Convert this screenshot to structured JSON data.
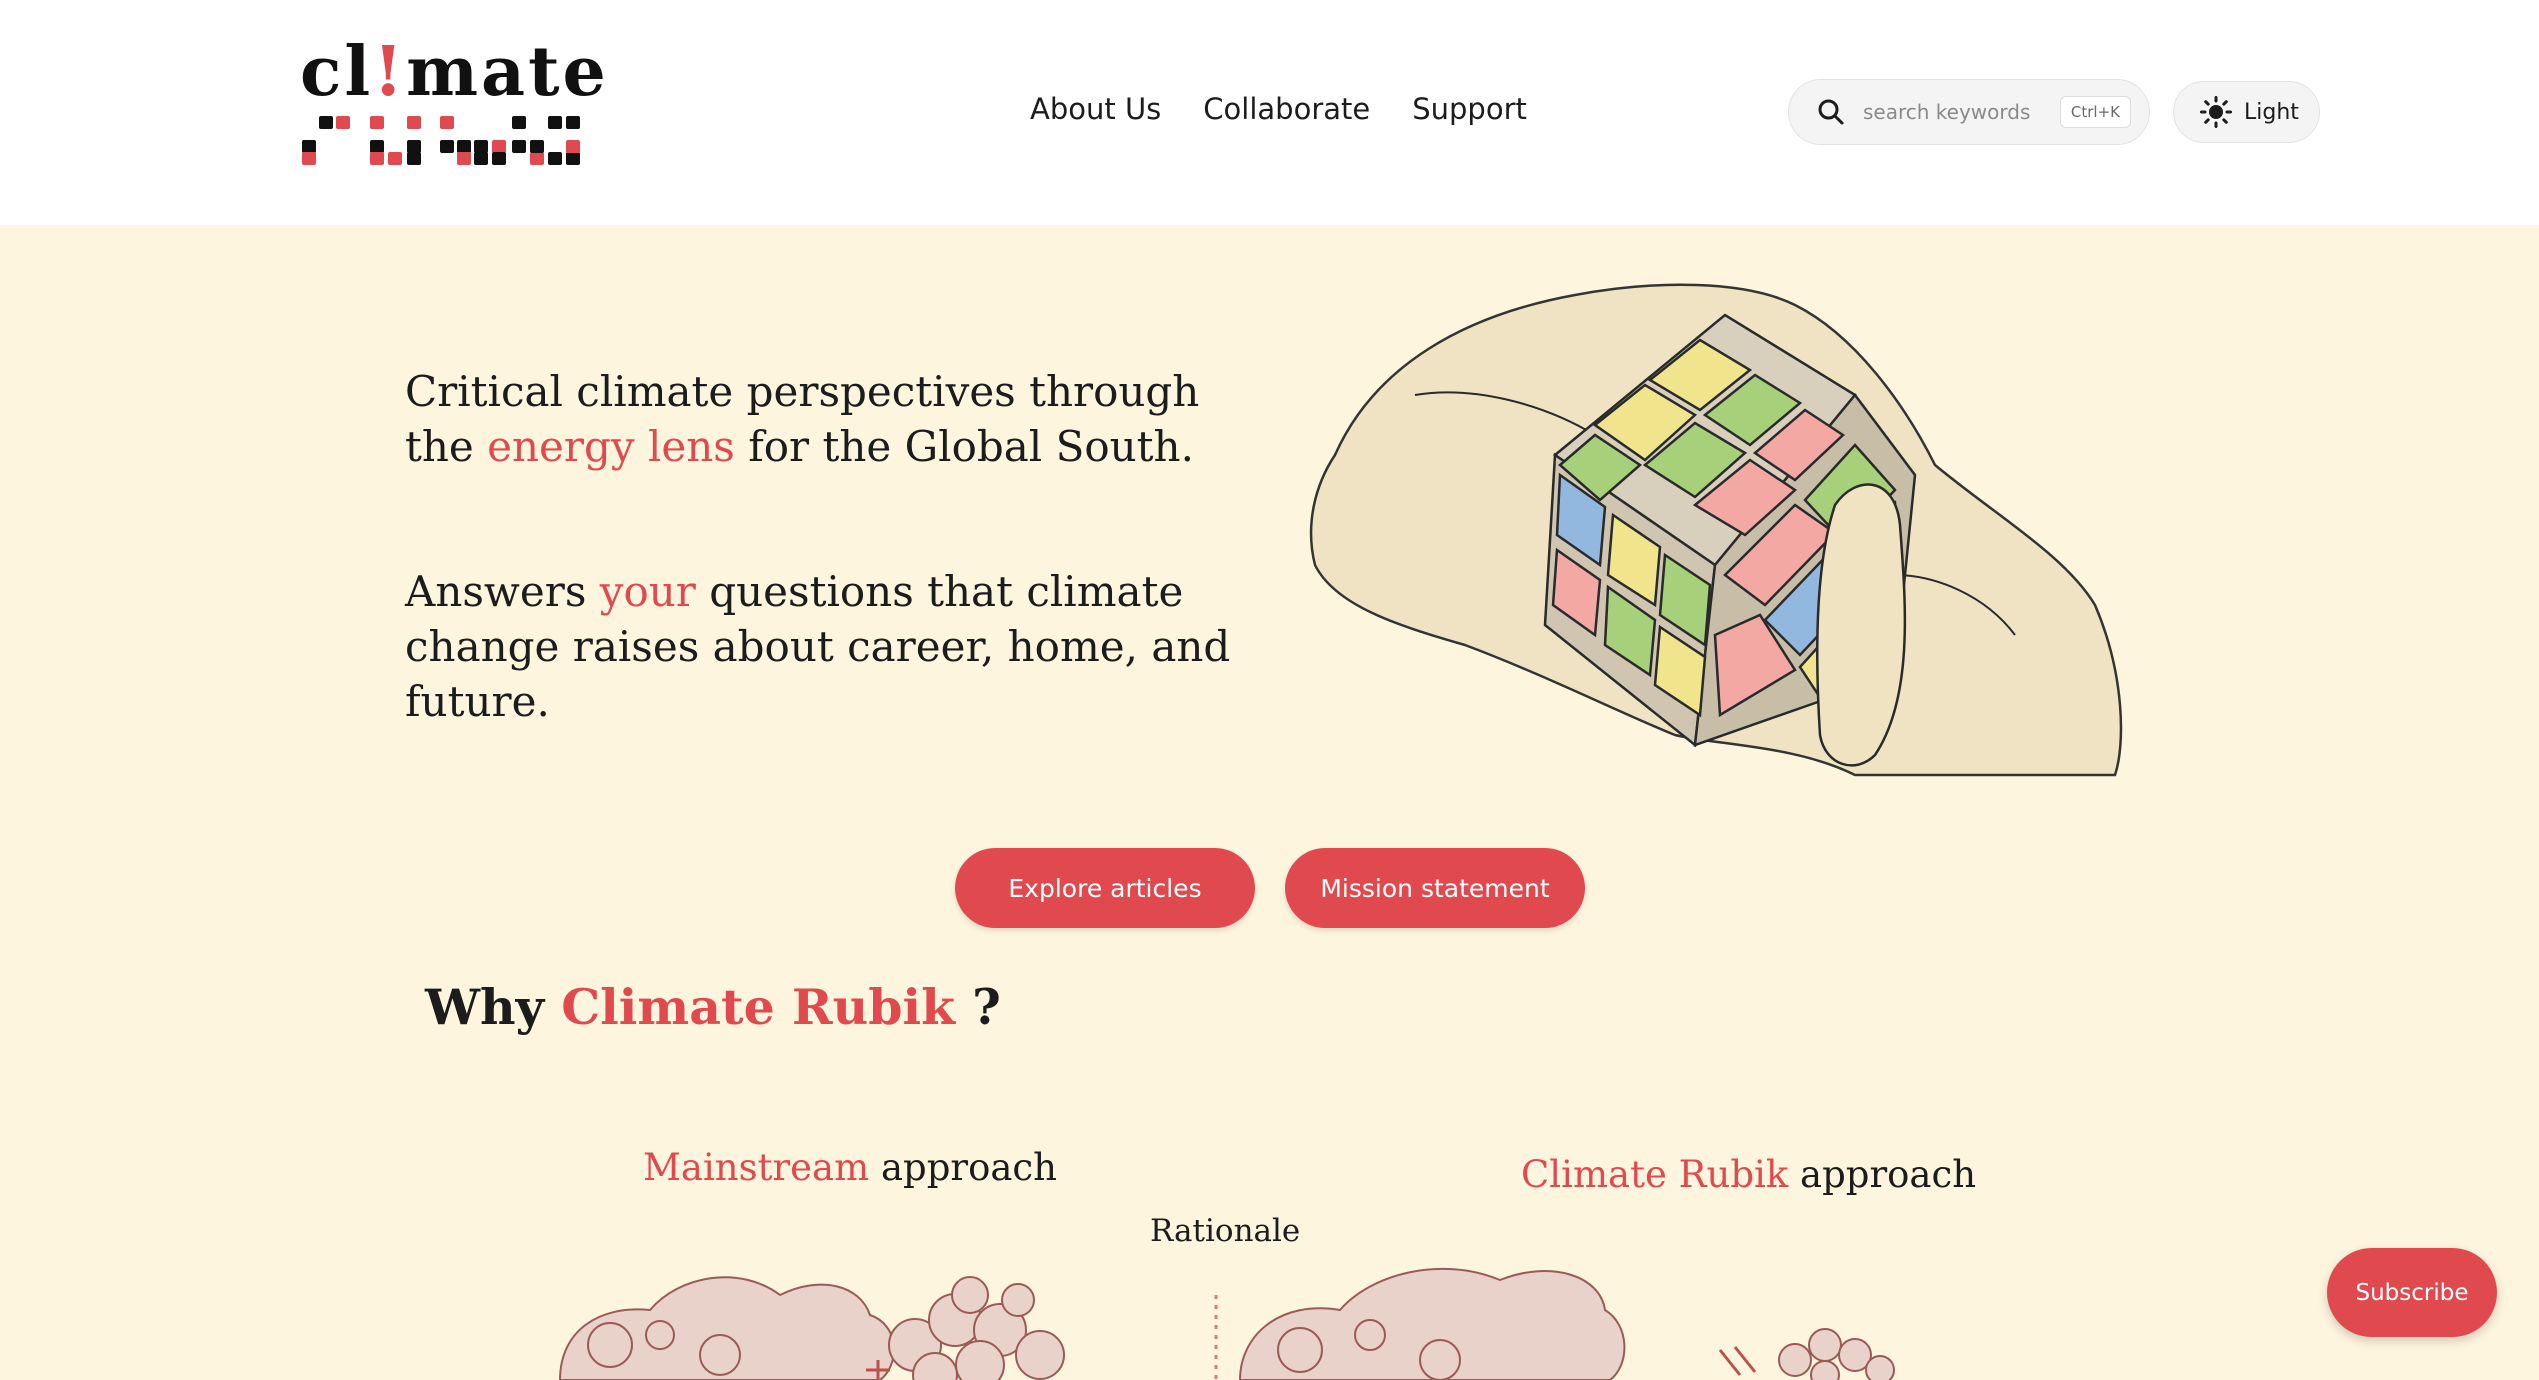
{
  "brand": {
    "logo_text_before": "cl",
    "logo_text_mark": "!",
    "logo_text_after": "mate",
    "accent_color": "#e04a4f"
  },
  "nav": {
    "items": [
      "About Us",
      "Collaborate",
      "Support"
    ]
  },
  "search": {
    "placeholder": "search keywords",
    "shortcut": "Ctrl+K",
    "icon": "search-icon"
  },
  "theme": {
    "label": "Light",
    "icon": "sun-icon"
  },
  "hero": {
    "line1_before": "Critical climate perspectives through the ",
    "line1_accent": "energy lens",
    "line1_after": " for the Global South.",
    "line2_before": "Answers ",
    "line2_accent": "your",
    "line2_after": " questions that climate change raises about career, home, and future."
  },
  "buttons": {
    "explore": "Explore articles",
    "mission": "Mission statement"
  },
  "why": {
    "before": "Why ",
    "accent": "Climate Rubik",
    "after": " ?"
  },
  "approaches": {
    "left_accent": "Mainstream",
    "left_rest": " approach",
    "right_accent": "Climate Rubik",
    "right_rest": " approach",
    "rationale": "Rationale"
  },
  "subscribe": {
    "label": "Subscribe"
  }
}
